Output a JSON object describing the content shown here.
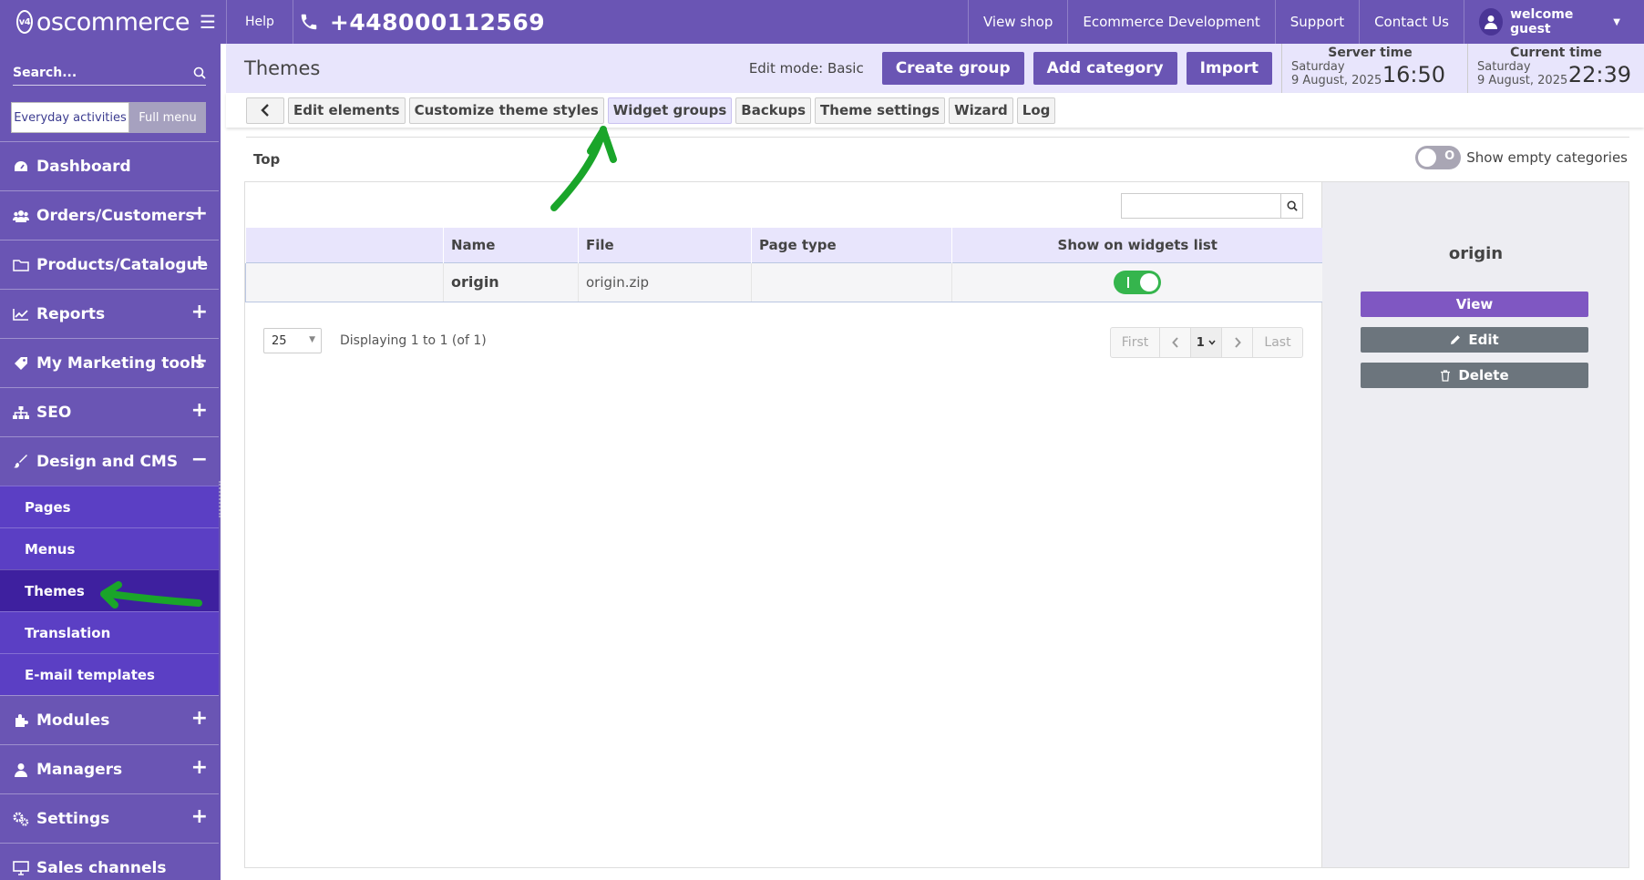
{
  "app": {
    "logo_text": "oscommerce",
    "logo_mark": "v4"
  },
  "topbar": {
    "help": "Help",
    "phone": "+448000112569",
    "links": [
      "View shop",
      "Ecommerce Development",
      "Support",
      "Contact Us"
    ],
    "user": "welcome guest"
  },
  "sidebar": {
    "search_placeholder": "Search...",
    "toggle_active": "Everyday activities",
    "toggle_inactive": "Full menu",
    "items": [
      {
        "label": "Dashboard",
        "icon": "dashboard-icon"
      },
      {
        "label": "Orders/Customers",
        "icon": "users-icon"
      },
      {
        "label": "Products/Catalogue",
        "icon": "folder-icon"
      },
      {
        "label": "Reports",
        "icon": "chart-icon"
      },
      {
        "label": "My Marketing tools",
        "icon": "tag-icon"
      },
      {
        "label": "SEO",
        "icon": "sitemap-icon"
      },
      {
        "label": "Design and CMS",
        "icon": "brush-icon"
      },
      {
        "label": "Modules",
        "icon": "puzzle-icon"
      },
      {
        "label": "Managers",
        "icon": "user-icon"
      },
      {
        "label": "Settings",
        "icon": "gears-icon"
      },
      {
        "label": "Sales channels",
        "icon": "monitor-icon"
      }
    ],
    "submenu": [
      "Pages",
      "Menus",
      "Themes",
      "Translation",
      "E-mail templates"
    ]
  },
  "header": {
    "title": "Themes",
    "edit_mode": "Edit mode: Basic",
    "buttons": [
      "Create group",
      "Add category",
      "Import"
    ],
    "server_time": {
      "label": "Server time",
      "day": "Saturday",
      "date": "9 August, 2025",
      "time": "16:50"
    },
    "current_time": {
      "label": "Current time",
      "day": "Saturday",
      "date": "9 August, 2025",
      "time": "22:39"
    }
  },
  "tabs": [
    "Edit elements",
    "Customize theme styles",
    "Widget groups",
    "Backups",
    "Theme settings",
    "Wizard",
    "Log"
  ],
  "content": {
    "section": "Top",
    "empty_toggle_state": "O",
    "empty_toggle_label": "Show empty categories",
    "columns": [
      "",
      "Name",
      "File",
      "Page type",
      "Show on widgets list"
    ],
    "rows": [
      {
        "name": "origin",
        "file": "origin.zip",
        "page_type": "",
        "show_on_widgets": true
      }
    ],
    "per_page": "25",
    "displaying": "Displaying 1 to 1 (of 1)",
    "pager": {
      "first": "First",
      "page": "1",
      "last": "Last"
    }
  },
  "side_panel": {
    "title": "origin",
    "view": "View",
    "edit": "Edit",
    "delete": "Delete"
  },
  "colors": {
    "brand": "#6a55b4",
    "accent": "#7f57c2",
    "toggle_on": "#35b54d",
    "annotation": "#1aa52a"
  }
}
